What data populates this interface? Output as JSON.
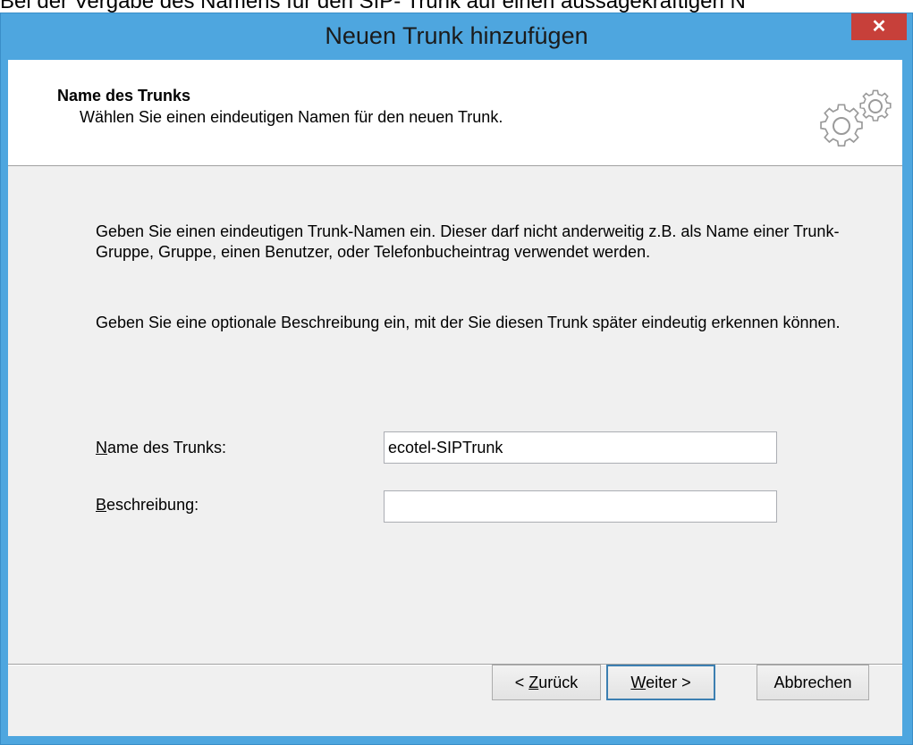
{
  "background_caption": "Bei der Vergabe des Namens für den SIP- Trunk auf einen aussagekräftigen N",
  "window": {
    "title": "Neuen Trunk hinzufügen",
    "close_glyph": "✕"
  },
  "header": {
    "title": "Name des Trunks",
    "subtitle": "Wählen Sie einen eindeutigen Namen für den neuen Trunk.",
    "icon": "gears-icon"
  },
  "body": {
    "paragraph1": "Geben Sie einen eindeutigen Trunk-Namen ein. Dieser darf nicht anderweitig z.B. als Name einer Trunk-Gruppe, Gruppe, einen Benutzer, oder Telefonbucheintrag verwendet werden.",
    "paragraph2": "Geben Sie eine optionale Beschreibung ein, mit der Sie diesen Trunk später eindeutig erkennen können."
  },
  "fields": {
    "name": {
      "label_accel": "N",
      "label_rest": "ame des Trunks:",
      "value": "ecotel-SIPTrunk"
    },
    "description": {
      "label_accel": "B",
      "label_rest": "eschreibung:",
      "value": ""
    }
  },
  "buttons": {
    "back": {
      "pre": "< ",
      "accel": "Z",
      "rest": "urück"
    },
    "next": {
      "accel": "W",
      "rest": "eiter >"
    },
    "cancel": "Abbrechen"
  }
}
